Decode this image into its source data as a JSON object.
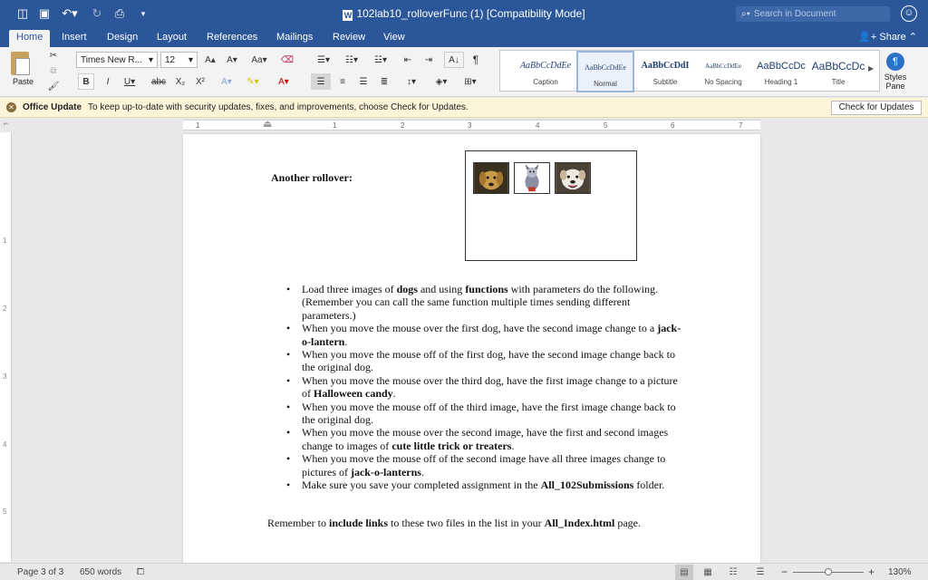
{
  "window": {
    "title": "102lab10_rolloverFunc (1) [Compatibility Mode]",
    "search_placeholder": "Search in Document"
  },
  "tabs": [
    "Home",
    "Insert",
    "Design",
    "Layout",
    "References",
    "Mailings",
    "Review",
    "View"
  ],
  "active_tab": "Home",
  "share_label": "Share",
  "ribbon": {
    "paste_label": "Paste",
    "font_name": "Times New R...",
    "font_size": "12",
    "styles": [
      {
        "preview": "AaBbCcDdEe",
        "name": "Caption"
      },
      {
        "preview": "AaBbCcDdEe",
        "name": "Normal"
      },
      {
        "preview": "AaBbCcDdI",
        "name": "Subtitle"
      },
      {
        "preview": "AaBbCcDdEe",
        "name": "No Spacing"
      },
      {
        "preview": "AaBbCcDc",
        "name": "Heading 1"
      },
      {
        "preview": "AaBbCcDc",
        "name": "Title"
      }
    ],
    "styles_pane_label": "Styles Pane"
  },
  "message_bar": {
    "title": "Office Update",
    "text": "To keep up-to-date with security updates, fixes, and improvements, choose Check for Updates.",
    "button": "Check for Updates"
  },
  "ruler_numbers": [
    "1",
    "1",
    "2",
    "3",
    "4",
    "5",
    "6",
    "7"
  ],
  "vruler_numbers": [
    "1",
    "2",
    "3",
    "4",
    "5"
  ],
  "document": {
    "rollover_label": "Another rollover:",
    "tasks": [
      [
        {
          "t": "Load three images of "
        },
        {
          "t": "dogs",
          "b": true
        },
        {
          "t": " and using "
        },
        {
          "t": "functions",
          "b": true
        },
        {
          "t": " with parameters do the following. (Remember you can call the same function multiple times sending different parameters.)"
        }
      ],
      [
        {
          "t": "When you move the mouse over the first dog, have the second image change to a "
        },
        {
          "t": "jack-o-lantern",
          "b": true
        },
        {
          "t": "."
        }
      ],
      [
        {
          "t": "When you move the mouse off of the first dog, have the second image change back to the original dog."
        }
      ],
      [
        {
          "t": "When you move the mouse over the third dog, have the first image change to a picture of "
        },
        {
          "t": "Halloween candy",
          "b": true
        },
        {
          "t": "."
        }
      ],
      [
        {
          "t": "When you move the mouse off of the third image, have the first image change back to the original dog."
        }
      ],
      [
        {
          "t": "When you move the mouse over the second image, have the first and second images change to images of "
        },
        {
          "t": "cute little trick or treaters",
          "b": true
        },
        {
          "t": "."
        }
      ],
      [
        {
          "t": "When you move the mouse off of the second image have all three images change to  pictures of "
        },
        {
          "t": "jack-o-lanterns",
          "b": true
        },
        {
          "t": "."
        }
      ],
      [
        {
          "t": "Make sure you save your completed assignment in the "
        },
        {
          "t": "All_102Submissions",
          "b": true
        },
        {
          "t": " folder."
        }
      ]
    ],
    "footer": [
      {
        "t": "Remember to "
      },
      {
        "t": "include links",
        "b": true
      },
      {
        "t": " to these two files in the list in your "
      },
      {
        "t": "All_Index.html",
        "b": true
      },
      {
        "t": " page."
      }
    ]
  },
  "status": {
    "page": "Page 3 of 3",
    "words": "650 words",
    "zoom": "130%",
    "zoom_fraction": 0.5
  }
}
